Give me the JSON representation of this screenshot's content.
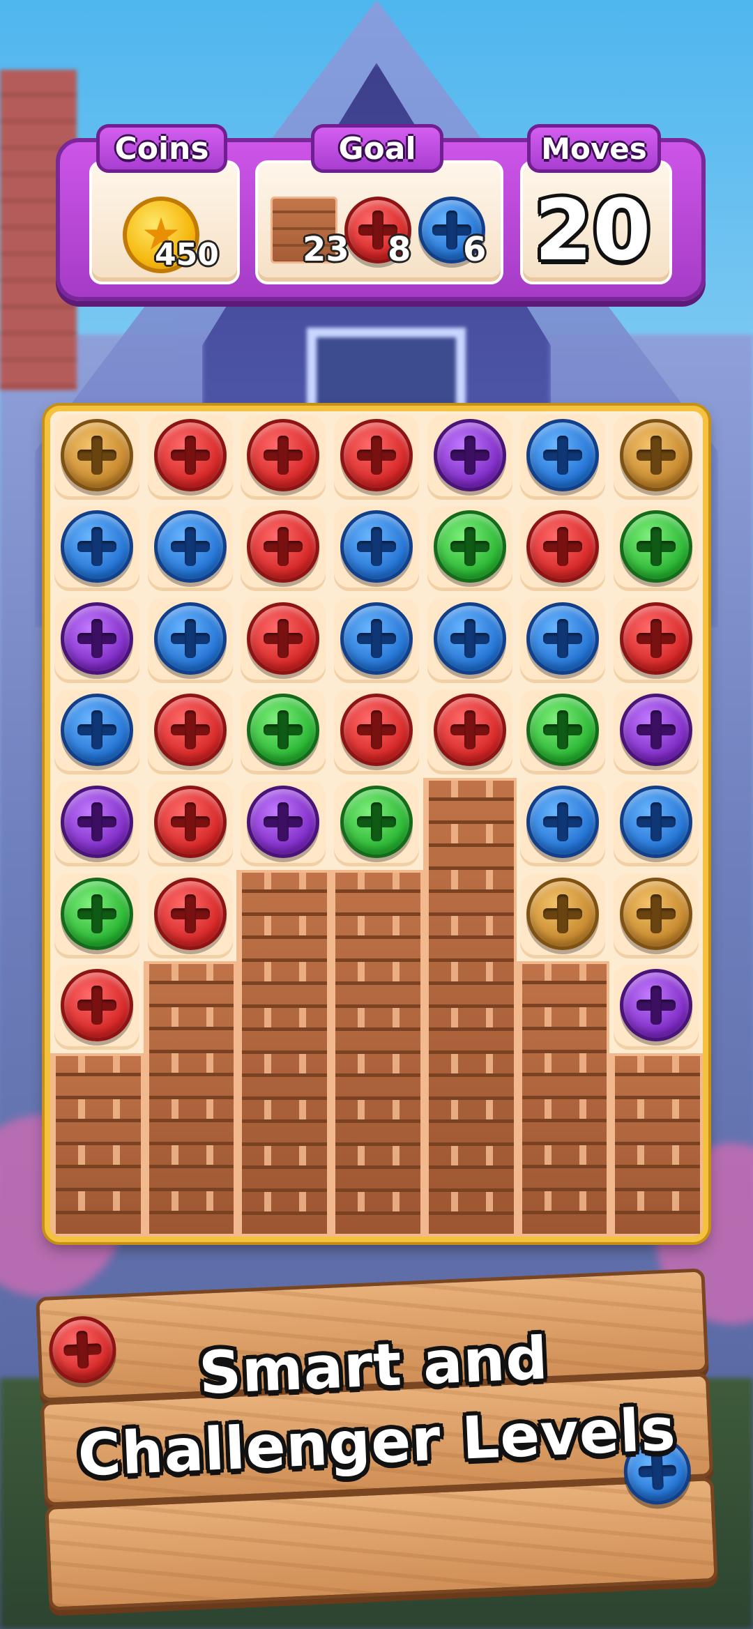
{
  "hud": {
    "coins_label": "Coins",
    "coins_value": "450",
    "goal_label": "Goal",
    "goals": [
      {
        "icon": "brick-icon",
        "count": "23"
      },
      {
        "icon": "red-screw-icon",
        "count": "8"
      },
      {
        "icon": "blue-screw-icon",
        "count": "6"
      }
    ],
    "moves_label": "Moves",
    "moves_value": "20"
  },
  "colors": {
    "red": "#e23a3a",
    "blue": "#2f86e0",
    "green": "#33c13d",
    "purple": "#8a33c9",
    "gold": "#d2962c",
    "hud_purple": "#b645d8",
    "board_border": "#f4c23f"
  },
  "board": {
    "columns": 7,
    "rows": 9,
    "screws": [
      [
        "gold",
        "red",
        "red",
        "red",
        "purple",
        "blue",
        "gold"
      ],
      [
        "blue",
        "blue",
        "red",
        "blue",
        "green",
        "red",
        "green"
      ],
      [
        "purple",
        "blue",
        "red",
        "blue",
        "blue",
        "blue",
        "red"
      ],
      [
        "blue",
        "red",
        "green",
        "red",
        "red",
        "green",
        "purple"
      ],
      [
        "purple",
        "red",
        "purple",
        "green",
        "",
        "blue",
        "blue"
      ],
      [
        "green",
        "red",
        "",
        "",
        "",
        "gold",
        "gold"
      ],
      [
        "red",
        "",
        "",
        "",
        "",
        "",
        "purple"
      ],
      [
        "",
        "",
        "",
        "",
        "",
        "",
        ""
      ],
      [
        "",
        "",
        "",
        "",
        "",
        "",
        ""
      ]
    ],
    "brick_column_heights": [
      2,
      3,
      4,
      4,
      5,
      3,
      2
    ]
  },
  "banner": {
    "line1": "Smart and",
    "line2": "Challenger Levels"
  }
}
